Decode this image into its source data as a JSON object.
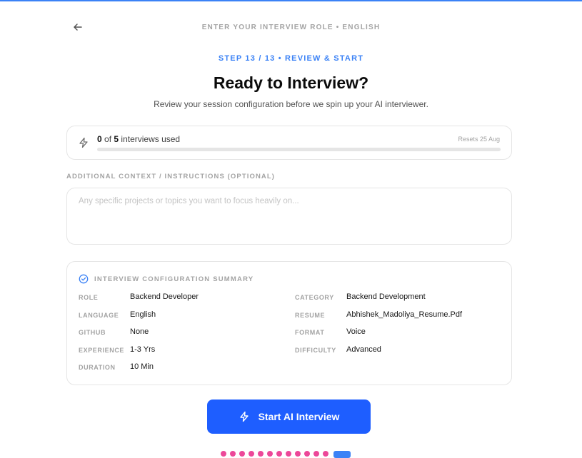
{
  "header": {
    "title": "ENTER YOUR INTERVIEW ROLE • ENGLISH"
  },
  "step": {
    "label": "STEP 13 / 13 • REVIEW & START",
    "current": 13,
    "total": 13
  },
  "page": {
    "title": "Ready to Interview?",
    "subtitle": "Review your session configuration before we spin up your AI interviewer."
  },
  "usage": {
    "used": "0",
    "of_label": " of ",
    "limit": "5",
    "suffix": " interviews used",
    "reset": "Resets 25 Aug",
    "progress_percent": 0
  },
  "context": {
    "label": "ADDITIONAL CONTEXT / INSTRUCTIONS (OPTIONAL)",
    "value": "",
    "placeholder": "Any specific projects or topics you want to focus heavily on..."
  },
  "summary": {
    "title": "INTERVIEW CONFIGURATION SUMMARY",
    "items": [
      {
        "key": "ROLE",
        "value": "Backend Developer"
      },
      {
        "key": "CATEGORY",
        "value": "Backend Development"
      },
      {
        "key": "LANGUAGE",
        "value": "English"
      },
      {
        "key": "RESUME",
        "value": "Abhishek_Madoliya_Resume.Pdf"
      },
      {
        "key": "GITHUB",
        "value": "None"
      },
      {
        "key": "FORMAT",
        "value": "Voice"
      },
      {
        "key": "EXPERIENCE",
        "value": "1-3 Yrs"
      },
      {
        "key": "DIFFICULTY",
        "value": "Advanced"
      },
      {
        "key": "DURATION",
        "value": "10 Min"
      }
    ]
  },
  "actions": {
    "start_label": "Start AI Interview"
  },
  "icons": {
    "back": "arrow-left-icon",
    "usage": "bolt-icon",
    "summary": "check-circle-icon",
    "start": "bolt-icon"
  },
  "colors": {
    "accent": "#3b82f6",
    "button": "#1e5eff",
    "dots": "#ec4899"
  }
}
